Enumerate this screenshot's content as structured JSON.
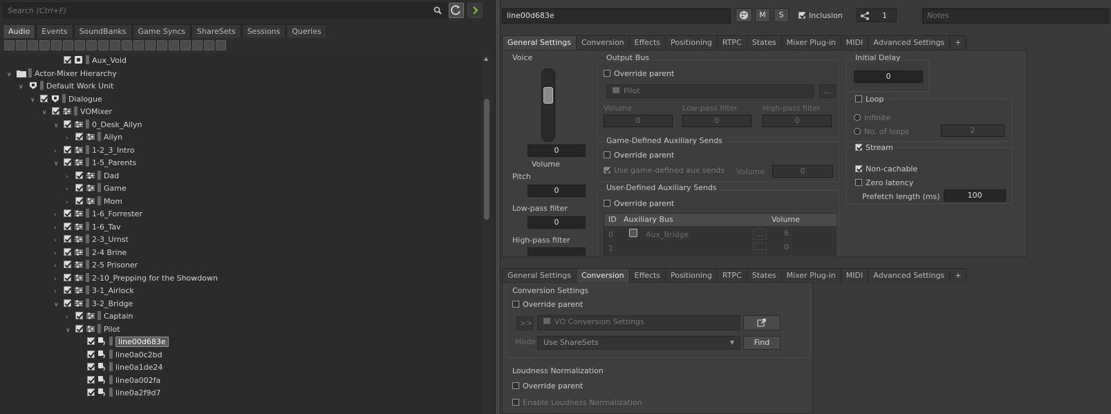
{
  "left": {
    "search_placeholder": "Search (Ctrl+F)",
    "tabs": [
      "Audio",
      "Events",
      "SoundBanks",
      "Game Syncs",
      "ShareSets",
      "Sessions",
      "Queries"
    ],
    "tree": [
      {
        "label": "Aux_Void",
        "depth": 4,
        "arrow": "",
        "icon": "aux-bus"
      },
      {
        "label": "Actor-Mixer Hierarchy",
        "depth": 0,
        "arrow": "v",
        "icon": "folder"
      },
      {
        "label": "Default Work Unit",
        "depth": 1,
        "arrow": "v",
        "icon": "work-unit"
      },
      {
        "label": "Dialogue",
        "depth": 2,
        "arrow": "v",
        "icon": "work-unit"
      },
      {
        "label": "VOMixer",
        "depth": 3,
        "arrow": "v",
        "icon": "actor-mixer"
      },
      {
        "label": "0_Desk_Ailyn",
        "depth": 4,
        "arrow": "v",
        "icon": "actor-mixer"
      },
      {
        "label": "Ailyn",
        "depth": 5,
        "arrow": ">",
        "icon": "actor-mixer"
      },
      {
        "label": "1-2_3_Intro",
        "depth": 4,
        "arrow": ">",
        "icon": "actor-mixer"
      },
      {
        "label": "1-5_Parents",
        "depth": 4,
        "arrow": "v",
        "icon": "actor-mixer"
      },
      {
        "label": "Dad",
        "depth": 5,
        "arrow": ">",
        "icon": "actor-mixer"
      },
      {
        "label": "Game",
        "depth": 5,
        "arrow": ">",
        "icon": "actor-mixer"
      },
      {
        "label": "Mom",
        "depth": 5,
        "arrow": ">",
        "icon": "actor-mixer"
      },
      {
        "label": "1-6_Forrester",
        "depth": 4,
        "arrow": ">",
        "icon": "actor-mixer"
      },
      {
        "label": "1-6_Tav",
        "depth": 4,
        "arrow": ">",
        "icon": "actor-mixer"
      },
      {
        "label": "2-3_Urnst",
        "depth": 4,
        "arrow": ">",
        "icon": "actor-mixer"
      },
      {
        "label": "2-4 Brine",
        "depth": 4,
        "arrow": ">",
        "icon": "actor-mixer"
      },
      {
        "label": "2-5 Prisoner",
        "depth": 4,
        "arrow": ">",
        "icon": "actor-mixer"
      },
      {
        "label": "2-10_Prepping for the Showdown",
        "depth": 4,
        "arrow": ">",
        "icon": "actor-mixer"
      },
      {
        "label": "3-1_Airlock",
        "depth": 4,
        "arrow": ">",
        "icon": "actor-mixer"
      },
      {
        "label": "3-2_Bridge",
        "depth": 4,
        "arrow": "v",
        "icon": "actor-mixer"
      },
      {
        "label": "Captain",
        "depth": 5,
        "arrow": ">",
        "icon": "actor-mixer"
      },
      {
        "label": "Pilot",
        "depth": 5,
        "arrow": "v",
        "icon": "actor-mixer"
      },
      {
        "label": "line00d683e",
        "depth": 6,
        "arrow": "",
        "icon": "voice",
        "selected": true
      },
      {
        "label": "line0a0c2bd",
        "depth": 6,
        "arrow": "",
        "icon": "voice"
      },
      {
        "label": "line0a1de24",
        "depth": 6,
        "arrow": "",
        "icon": "voice"
      },
      {
        "label": "line0a002fa",
        "depth": 6,
        "arrow": "",
        "icon": "voice"
      },
      {
        "label": "line0a2f9d7",
        "depth": 6,
        "arrow": "",
        "icon": "voice"
      }
    ]
  },
  "header": {
    "object_name": "line00d683e",
    "m_label": "M",
    "s_label": "S",
    "inclusion_label": "Inclusion",
    "share_count": "1",
    "notes_placeholder": "Notes"
  },
  "tabs_top": [
    "General Settings",
    "Conversion",
    "Effects",
    "Positioning",
    "RTPC",
    "States",
    "Mixer Plug-in",
    "MIDI",
    "Advanced Settings",
    "+"
  ],
  "tabs_bottom": [
    "General Settings",
    "Conversion",
    "Effects",
    "Positioning",
    "RTPC",
    "States",
    "Mixer Plug-in",
    "MIDI",
    "Advanced Settings",
    "+"
  ],
  "general": {
    "voice_label": "Voice",
    "volume_value": "0",
    "volume_label": "Volume",
    "pitch_label": "Pitch",
    "pitch_value": "0",
    "lpf_label": "Low-pass filter",
    "lpf_value": "0",
    "hpf_label": "High-pass filter",
    "output_bus_label": "Output Bus",
    "override_parent": "Override parent",
    "bus_name": "Pilot",
    "bus_browse": "...",
    "ob_volume_label": "Volume",
    "ob_volume_value": "0",
    "ob_lpf_label": "Low-pass filter",
    "ob_lpf_value": "0",
    "ob_hpf_label": "High-pass filter",
    "ob_hpf_value": "0",
    "gd_aux_label": "Game-Defined Auxiliary Sends",
    "gd_use_label": "Use game-defined aux sends",
    "gd_volume_label": "Volume",
    "gd_volume_value": "0",
    "ud_aux_label": "User-Defined Auxiliary Sends",
    "aux_table": {
      "headers": [
        "ID",
        "Auxiliary Bus",
        "Volume"
      ],
      "rows": [
        {
          "id": "0",
          "bus": "Aux_Bridge",
          "volume": "6"
        },
        {
          "id": "1",
          "bus": "",
          "volume": "0"
        }
      ]
    },
    "initial_delay_label": "Initial Delay",
    "initial_delay_value": "0",
    "loop_label": "Loop",
    "infinite_label": "Infinite",
    "loops_label": "No. of loops",
    "loops_value": "2",
    "stream_label": "Stream",
    "noncachable_label": "Non-cachable",
    "zero_latency_label": "Zero latency",
    "prefetch_label": "Prefetch length (ms)",
    "prefetch_value": "100"
  },
  "conversion": {
    "settings_label": "Conversion Settings",
    "override_parent": "Override parent",
    "nav_label": ">>",
    "conversion_name": "VO Conversion Settings",
    "mode_label": "Mode",
    "mode_value": "Use ShareSets",
    "find_label": "Find",
    "loudness_label": "Loudness Normalization",
    "loudness_override": "Override parent",
    "enable_loudness": "Enable Loudness Normalization"
  }
}
